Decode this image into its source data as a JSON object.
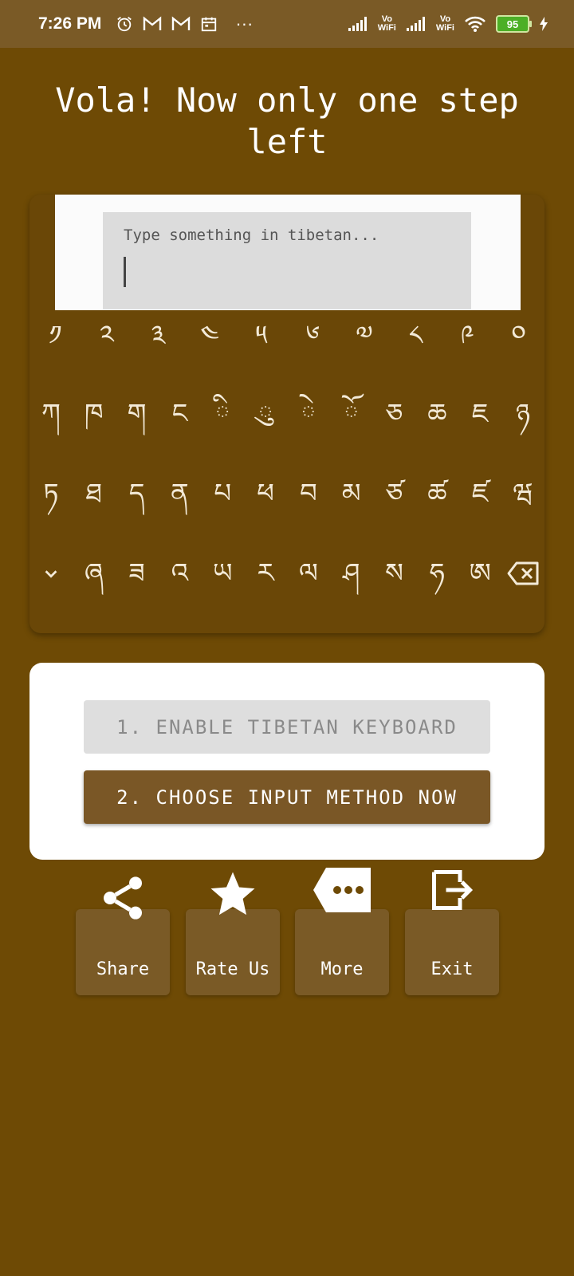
{
  "status_bar": {
    "time": "7:26 PM",
    "more": "···",
    "vo_label": "Vo",
    "wifi_label": "WiFi",
    "battery": "95"
  },
  "headline": "Vola! Now only one step left",
  "keyboard_preview": {
    "placeholder": "Type something in tibetan...",
    "row1": [
      "༡",
      "༢",
      "༣",
      "༤",
      "༥",
      "༦",
      "༧",
      "༨",
      "༩",
      "༠"
    ],
    "row2": [
      "ཀ",
      "ཁ",
      "ག",
      "ང",
      "ི",
      "ུ",
      "ེ",
      "ོ",
      "ཅ",
      "ཆ",
      "ཇ",
      "ཉ"
    ],
    "row3": [
      "ཏ",
      "ཐ",
      "ད",
      "ན",
      "པ",
      "ཕ",
      "བ",
      "མ",
      "ཙ",
      "ཚ",
      "ཛ",
      "ཝ"
    ],
    "row4": [
      "ཞ",
      "ཟ",
      "འ",
      "ཡ",
      "ར",
      "ལ",
      "ཤ",
      "ས",
      "ཧ",
      "ཨ"
    ]
  },
  "steps": {
    "enable_keyboard": "1. ENABLE TIBETAN KEYBOARD",
    "choose_input": "2. CHOOSE INPUT METHOD NOW"
  },
  "actions": {
    "share": "Share",
    "rate": "Rate Us",
    "more": "More",
    "exit": "Exit"
  },
  "icons": {
    "share": "share-icon",
    "rate": "star-icon",
    "more": "more-tag-icon",
    "exit": "exit-icon"
  },
  "colors": {
    "background": "#6e4a05",
    "status_bar": "#7a5a26",
    "primary_button": "#7a5726",
    "disabled_button": "#dedede"
  }
}
